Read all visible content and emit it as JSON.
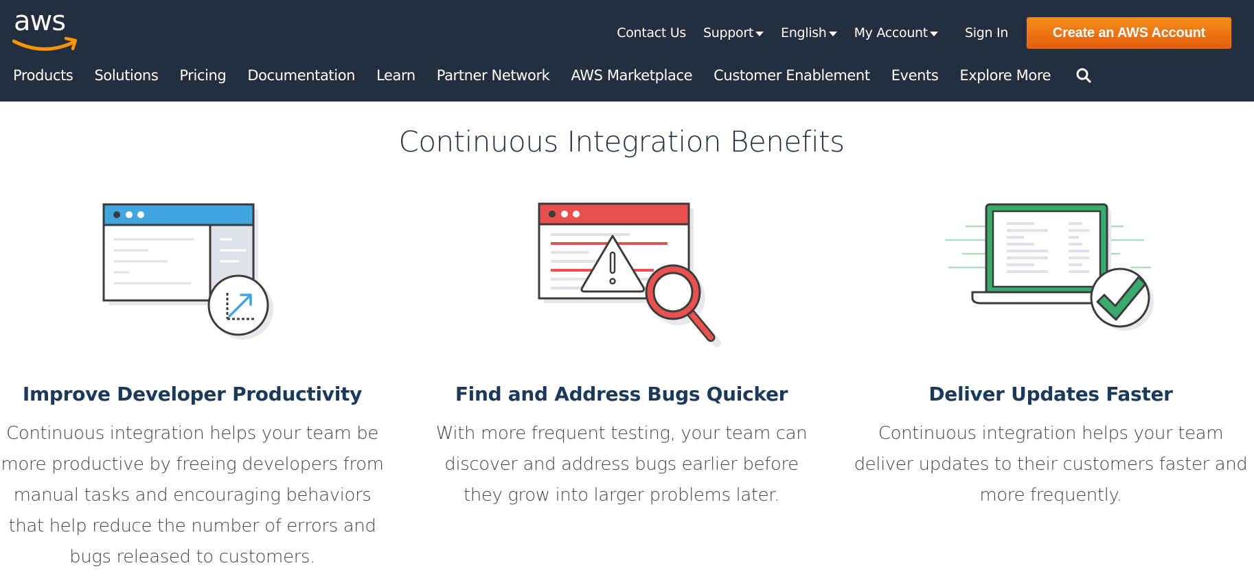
{
  "header": {
    "logo_text": "aws",
    "utility_nav": [
      {
        "label": "Contact Us",
        "dropdown": false
      },
      {
        "label": "Support",
        "dropdown": true
      },
      {
        "label": "English",
        "dropdown": true
      },
      {
        "label": "My Account",
        "dropdown": true
      }
    ],
    "sign_in": "Sign In",
    "cta_label": "Create an AWS Account",
    "main_nav": [
      "Products",
      "Solutions",
      "Pricing",
      "Documentation",
      "Learn",
      "Partner Network",
      "AWS Marketplace",
      "Customer Enablement",
      "Events",
      "Explore More"
    ],
    "search_icon": "search-icon"
  },
  "colors": {
    "header_bg": "#232f3e",
    "cta_orange": "#ec7211",
    "logo_smile": "#f79400",
    "blue_accent": "#3fa6e0",
    "red_accent": "#e9514f",
    "green_accent": "#3aaa6d",
    "title_color": "#232f3e"
  },
  "main": {
    "section_title": "Continuous Integration Benefits",
    "benefits": [
      {
        "icon": "browser-chart-icon",
        "title": "Improve Developer Productivity",
        "description": "Continuous integration helps your team be more productive by freeing developers from manual tasks and encouraging behaviors that help reduce the number of errors and bugs released to customers."
      },
      {
        "icon": "bug-search-icon",
        "title": "Find and Address Bugs Quicker",
        "description": "With more frequent testing, your team can discover and address bugs earlier before they grow into larger problems later."
      },
      {
        "icon": "laptop-checkmark-icon",
        "title": "Deliver Updates Faster",
        "description": "Continuous integration helps your team deliver updates to their customers faster and more frequently."
      }
    ]
  }
}
